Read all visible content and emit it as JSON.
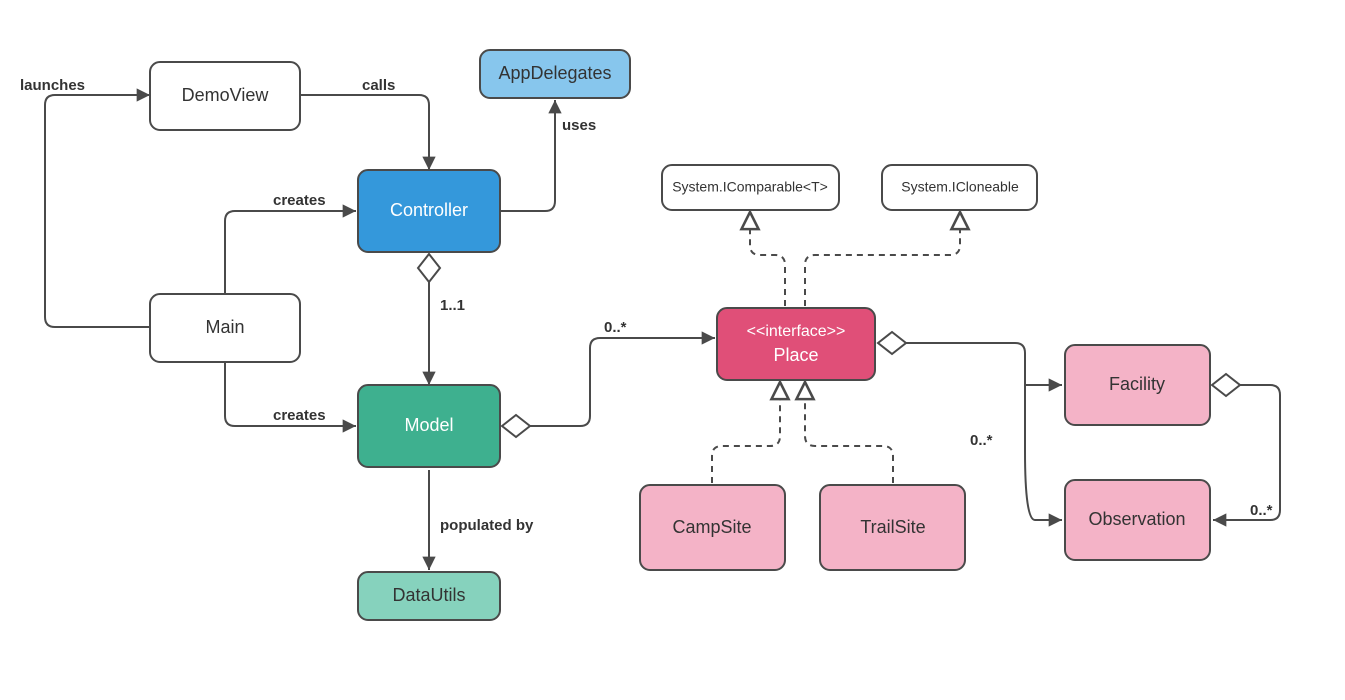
{
  "diagram": {
    "nodes": {
      "demoview": {
        "label": "DemoView",
        "fill": "#ffffff"
      },
      "main": {
        "label": "Main",
        "fill": "#ffffff"
      },
      "controller": {
        "label": "Controller",
        "fill": "#3498db"
      },
      "appdelegates": {
        "label": "AppDelegates",
        "fill": "#87c6ed"
      },
      "model": {
        "label": "Model",
        "fill": "#3eb08f"
      },
      "datautils": {
        "label": "DataUtils",
        "fill": "#86d2bd"
      },
      "icomparable": {
        "label": "System.IComparable<T>",
        "fill": "#ffffff"
      },
      "icloneable": {
        "label": "System.ICloneable",
        "fill": "#ffffff"
      },
      "place_stereo": {
        "label": "<<interface>>"
      },
      "place": {
        "label": "Place",
        "fill": "#e04f78"
      },
      "campsite": {
        "label": "CampSite",
        "fill": "#f4b3c7"
      },
      "trailsite": {
        "label": "TrailSite",
        "fill": "#f4b3c7"
      },
      "facility": {
        "label": "Facility",
        "fill": "#f4b3c7"
      },
      "observation": {
        "label": "Observation",
        "fill": "#f4b3c7"
      }
    },
    "edges": {
      "launches": "launches",
      "calls": "calls",
      "uses": "uses",
      "creates1": "creates",
      "creates2": "creates",
      "populated_by": "populated by",
      "mult_11": "1..1",
      "mult_0s_1": "0..*",
      "mult_0s_2": "0..*",
      "mult_0s_3": "0..*"
    }
  }
}
